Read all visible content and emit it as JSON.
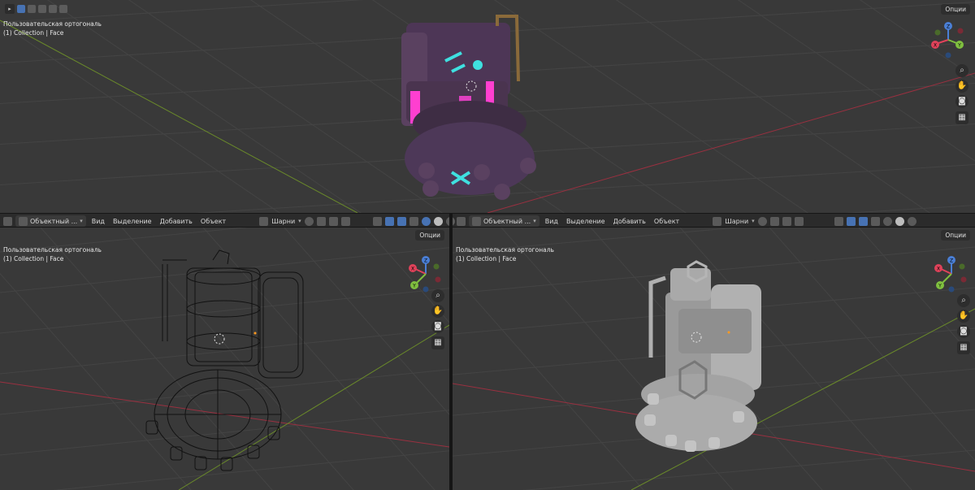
{
  "top_viewport": {
    "view_label": "Пользовательская ортогональ",
    "collection_label": "(1) Collection | Face",
    "options_label": "Опции"
  },
  "bottom_left_viewport": {
    "mode_label": "Объектный ...",
    "menu": {
      "view": "Вид",
      "select": "Выделение",
      "add": "Добавить",
      "object": "Объект"
    },
    "pivot_label": "Шарни",
    "view_label": "Пользовательская ортогональ",
    "collection_label": "(1) Collection | Face",
    "options_label": "Опции"
  },
  "bottom_right_viewport": {
    "mode_label": "Объектный ...",
    "menu": {
      "view": "Вид",
      "select": "Выделение",
      "add": "Добавить",
      "object": "Объект"
    },
    "pivot_label": "Шарни",
    "view_label": "Пользовательская ортогональ",
    "collection_label": "(1) Collection | Face",
    "options_label": "Опции"
  },
  "gizmo_axes": {
    "x": "X",
    "y": "Y",
    "z": "Z"
  },
  "colors": {
    "axis_x": "#e0425a",
    "axis_y": "#7fbf3f",
    "axis_z": "#4a7fd6",
    "accent_pink": "#ff3fd0",
    "accent_cyan": "#3fe0e0",
    "model_purple": "#5a4160",
    "model_solid": "#a9a9a9",
    "viewport_bg": "#393939"
  },
  "icons": [
    "zoom-icon",
    "hand-pan-icon",
    "camera-icon",
    "grid-ortho-icon",
    "cursor-icon"
  ]
}
